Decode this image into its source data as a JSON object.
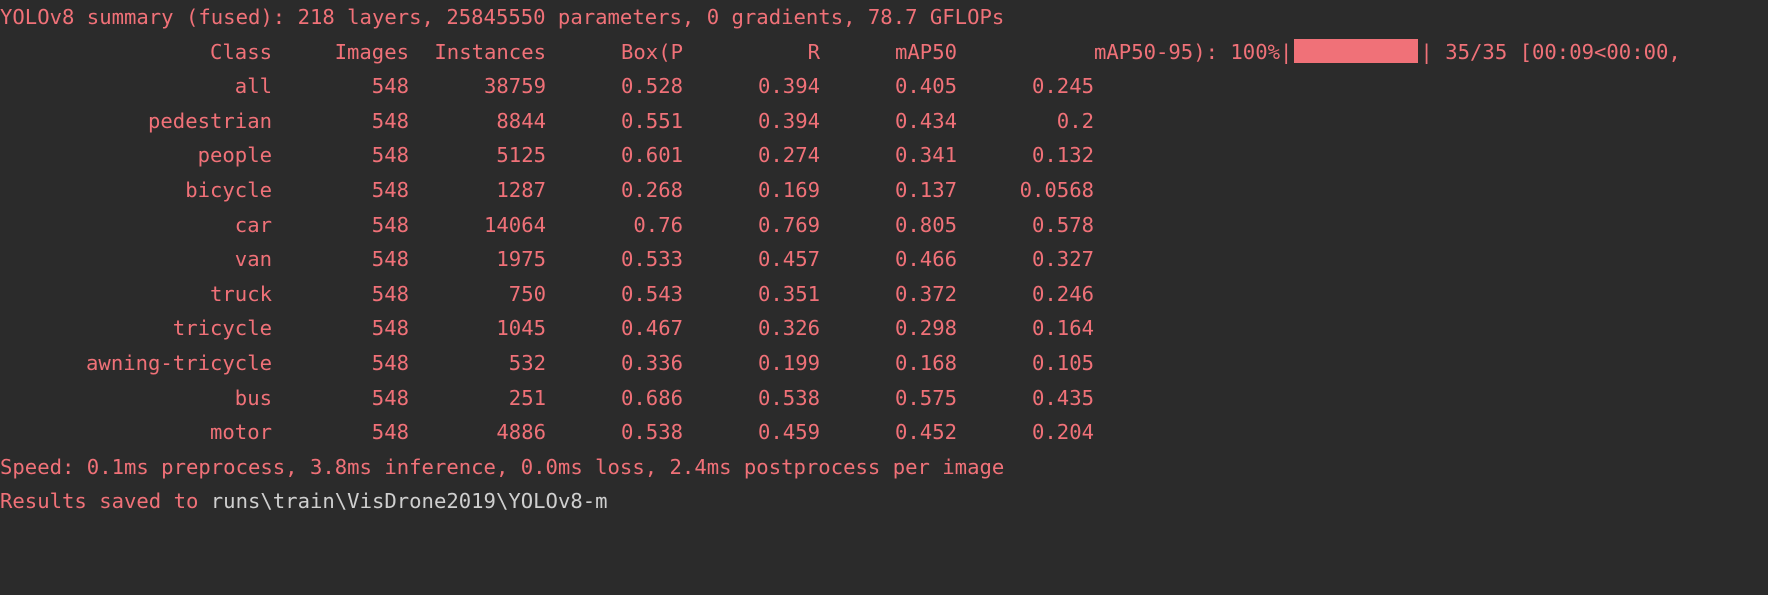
{
  "summary_line": "YOLOv8 summary (fused): 218 layers, 25845550 parameters, 0 gradients, 78.7 GFLOPs",
  "header": {
    "class": "Class",
    "images": "Images",
    "instances": "Instances",
    "box_p": "Box(P",
    "r": "R",
    "map50": "mAP50",
    "map50_95": "mAP50-95):",
    "progress_percent": "100%|",
    "progress_value": 1.0,
    "progress_end": "|",
    "progress_counter": "35/35 [00:09<00:00,"
  },
  "rows": [
    {
      "class": "all",
      "images": "548",
      "instances": "38759",
      "box_p": "0.528",
      "r": "0.394",
      "map50": "0.405",
      "map50_95": "0.245"
    },
    {
      "class": "pedestrian",
      "images": "548",
      "instances": "8844",
      "box_p": "0.551",
      "r": "0.394",
      "map50": "0.434",
      "map50_95": "0.2"
    },
    {
      "class": "people",
      "images": "548",
      "instances": "5125",
      "box_p": "0.601",
      "r": "0.274",
      "map50": "0.341",
      "map50_95": "0.132"
    },
    {
      "class": "bicycle",
      "images": "548",
      "instances": "1287",
      "box_p": "0.268",
      "r": "0.169",
      "map50": "0.137",
      "map50_95": "0.0568"
    },
    {
      "class": "car",
      "images": "548",
      "instances": "14064",
      "box_p": "0.76",
      "r": "0.769",
      "map50": "0.805",
      "map50_95": "0.578"
    },
    {
      "class": "van",
      "images": "548",
      "instances": "1975",
      "box_p": "0.533",
      "r": "0.457",
      "map50": "0.466",
      "map50_95": "0.327"
    },
    {
      "class": "truck",
      "images": "548",
      "instances": "750",
      "box_p": "0.543",
      "r": "0.351",
      "map50": "0.372",
      "map50_95": "0.246"
    },
    {
      "class": "tricycle",
      "images": "548",
      "instances": "1045",
      "box_p": "0.467",
      "r": "0.326",
      "map50": "0.298",
      "map50_95": "0.164"
    },
    {
      "class": "awning-tricycle",
      "images": "548",
      "instances": "532",
      "box_p": "0.336",
      "r": "0.199",
      "map50": "0.168",
      "map50_95": "0.105"
    },
    {
      "class": "bus",
      "images": "548",
      "instances": "251",
      "box_p": "0.686",
      "r": "0.538",
      "map50": "0.575",
      "map50_95": "0.435"
    },
    {
      "class": "motor",
      "images": "548",
      "instances": "4886",
      "box_p": "0.538",
      "r": "0.459",
      "map50": "0.452",
      "map50_95": "0.204"
    }
  ],
  "speed_line": "Speed: 0.1ms preprocess, 3.8ms inference, 0.0ms loss, 2.4ms postprocess per image",
  "results": {
    "prefix": "Results saved to ",
    "path": "runs\\train\\VisDrone2019\\YOLOv8-m"
  },
  "colors": {
    "background": "#2b2b2b",
    "text": "#f07178",
    "path": "#cfcfcf"
  }
}
